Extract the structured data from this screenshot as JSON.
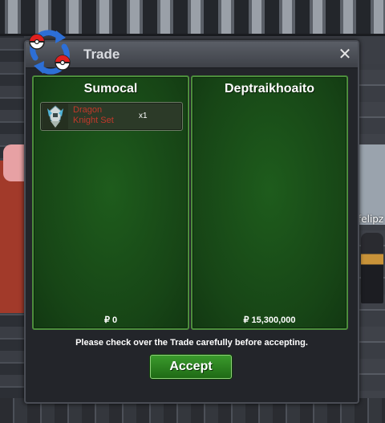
{
  "window": {
    "title": "Trade",
    "close_glyph": "✕"
  },
  "left_panel": {
    "player_name": "Sumocal",
    "items": [
      {
        "name": "Dragon Knight Set",
        "quantity": "x1",
        "icon": "dragon-knight-set-icon"
      }
    ],
    "currency_symbol": "₽",
    "money": "0"
  },
  "right_panel": {
    "player_name": "Deptraikhoaito",
    "items": [],
    "currency_symbol": "₽",
    "money": "15,300,000"
  },
  "notice": "Please check over the Trade carefully before accepting.",
  "accept_label": "Accept",
  "background": {
    "player_nametag": "felipz"
  },
  "colors": {
    "panel_green": "#1e5c1c",
    "accept_green": "#2e8a22",
    "item_name_red": "#c0392b"
  }
}
